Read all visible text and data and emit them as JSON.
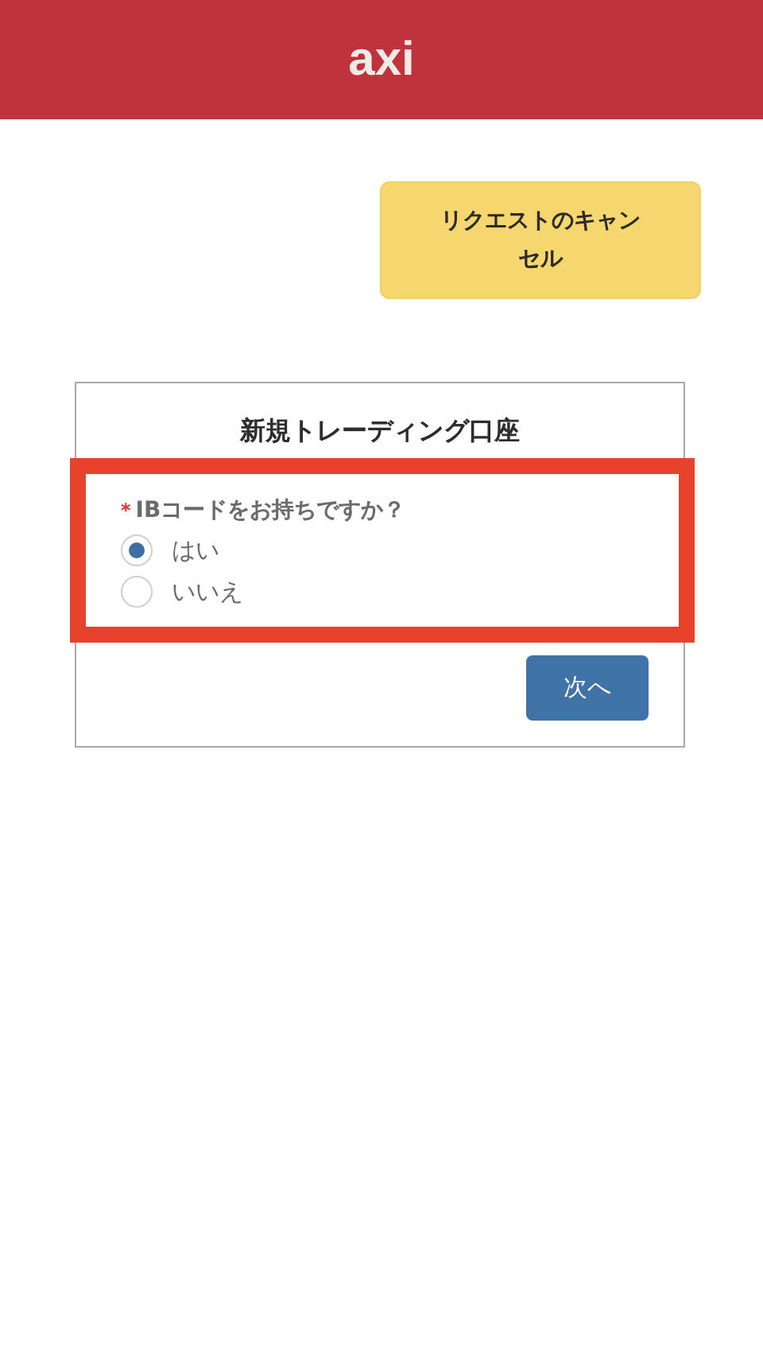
{
  "header": {
    "logo": "axi"
  },
  "cancel_button": {
    "label": "リクエストのキャンセル"
  },
  "form": {
    "title": "新規トレーディング口座",
    "highlighted": true,
    "question": {
      "required": true,
      "required_mark": "*",
      "label": "IBコードをお持ちですか？",
      "options": [
        {
          "label": "はい",
          "selected": true
        },
        {
          "label": "いいえ",
          "selected": false
        }
      ]
    },
    "next_button": {
      "label": "次へ"
    }
  }
}
